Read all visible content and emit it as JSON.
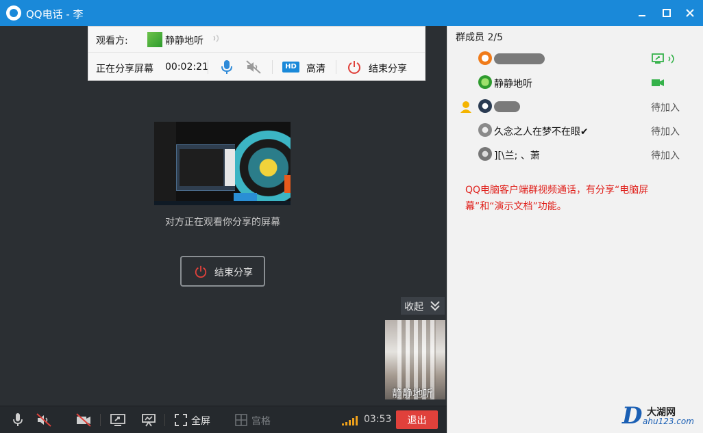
{
  "window": {
    "title": "QQ电话 - 李",
    "minimize_icon": "minimize-icon",
    "maximize_icon": "maximize-icon",
    "close_icon": "close-icon",
    "accent": "#1a89d9"
  },
  "share_bar": {
    "viewer_label": "观看方:",
    "viewer_name": "静静地听",
    "status": "正在分享屏幕",
    "timer": "00:02:21",
    "hd_badge": "HD",
    "hd_label": "高清",
    "end_label": "结束分享"
  },
  "stage": {
    "preview_caption": "对方正在观看你分享的屏幕",
    "end_share_button": "结束分享",
    "collapse_label": "收起",
    "thumbnail_name": "静静地听"
  },
  "toolbar": {
    "fullscreen_label": "全屏",
    "grid_label": "宫格",
    "call_time": "03:53",
    "exit_label": "退出",
    "exit_color": "#e0413b"
  },
  "members": {
    "title": "群成员 2/5",
    "items": [
      {
        "name": "",
        "status": "",
        "status_icons": [
          "screen-share-icon",
          "sound-wave-icon"
        ]
      },
      {
        "name": "静静地听",
        "status": "",
        "status_icons": [
          "camera-icon"
        ]
      },
      {
        "name": "",
        "status": "待加入",
        "host": true
      },
      {
        "name": "久念之人在梦不在眼✔",
        "status": "待加入"
      },
      {
        "name": "][\\兰; 、萧",
        "status": "待加入"
      }
    ]
  },
  "note": "QQ电脑客户端群视频通话，有分享“电脑屏幕”和“演示文档”功能。",
  "watermark": {
    "brand": "大湖网",
    "url": "ahu123.com"
  }
}
